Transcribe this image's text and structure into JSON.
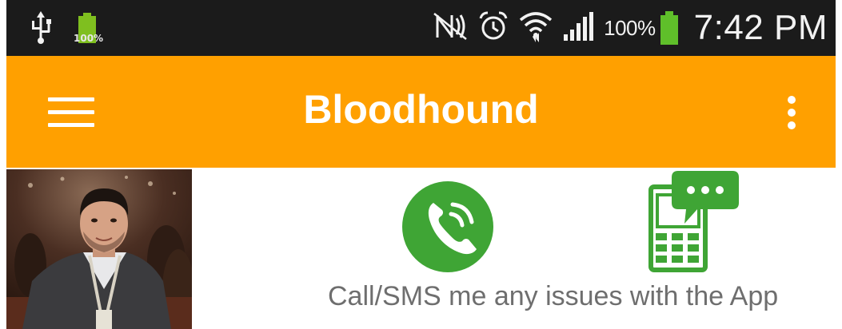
{
  "status_bar": {
    "battery_small_label": "100%",
    "battery_percent": "100%",
    "clock": "7:42 PM",
    "icons": [
      "usb-icon",
      "battery-icon",
      "nfc-icon",
      "alarm-icon",
      "wifi-icon",
      "signal-icon",
      "battery-full-icon"
    ]
  },
  "app_bar": {
    "title": "Bloodhound",
    "menu_icon": "hamburger-menu-icon",
    "overflow_icon": "more-vert-icon",
    "color": "#FFA000"
  },
  "content": {
    "support_text": "Call/SMS me any issues with the App",
    "call_icon": "phone-call-icon",
    "sms_icon": "sms-phone-icon",
    "accent_green": "#3FA535"
  }
}
